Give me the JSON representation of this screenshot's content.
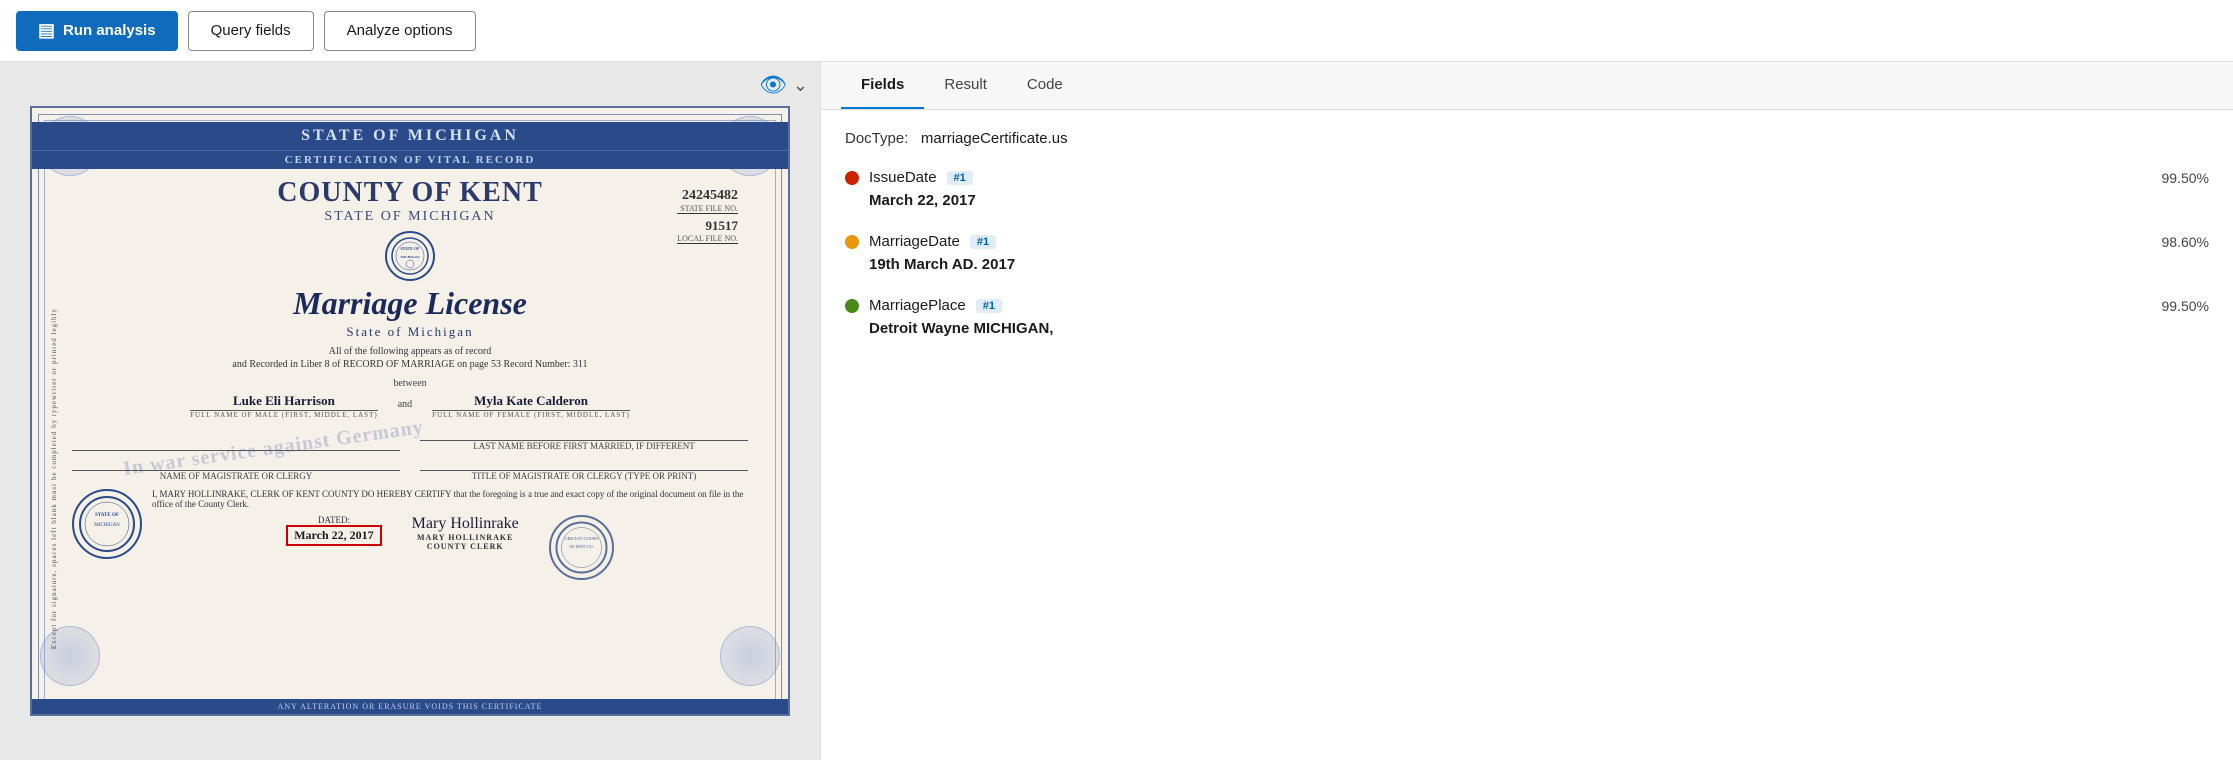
{
  "toolbar": {
    "run_analysis_label": "Run analysis",
    "query_fields_label": "Query fields",
    "analyze_options_label": "Analyze options",
    "run_icon": "▤"
  },
  "document": {
    "header_line1": "STATE OF MICHIGAN",
    "header_line2": "CERTIFICATION OF VITAL RECORD",
    "county": "COUNTY OF KENT",
    "state": "STATE OF MICHIGAN",
    "file_number_1": "24245482",
    "file_label_1": "STATE FILE NO.",
    "file_number_2": "91517",
    "file_label_2": "LOCAL FILE NO.",
    "title": "Marriage License",
    "subtitle": "State of Michigan",
    "body_text1": "All of the following appears as of record",
    "body_text2": "and Recorded in Liber  8  of RECORD OF MARRIAGE on page  53  Record Number:  311",
    "between_text": "between",
    "groom_name": "Luke Eli Harrison",
    "groom_label": "FULL NAME OF MALE (FIRST, MIDDLE, LAST)",
    "and_text": "and",
    "bride_name": "Myla Kate Calderon",
    "bride_label": "FULL NAME OF FEMALE (FIRST, MIDDLE, LAST)",
    "last_name_label": "LAST NAME BEFORE FIRST MARRIED, IF DIFFERENT",
    "magistrate_label": "NAME OF MAGISTRATE OR CLERGY",
    "title_label": "TITLE OF MAGISTRATE OR CLERGY (TYPE OR PRINT)",
    "ww2_stamp": "In war service against Germany",
    "certify_text": "I, MARY HOLLINRAKE, CLERK OF KENT COUNTY DO HEREBY CERTIFY that the foregoing is a true and exact copy of the original document on file in the office of the County Clerk.",
    "dated_label": "DATED:",
    "date_value": "March 22, 2017",
    "clerk_name": "Mary Hollinrake",
    "clerk_title": "MARY HOLLINRAKE",
    "clerk_role": "COUNTY CLERK",
    "footer_text": "ANY ALTERATION OR ERASURE VOIDS THIS CERTIFICATE"
  },
  "panel": {
    "tabs": [
      {
        "id": "fields",
        "label": "Fields",
        "active": true
      },
      {
        "id": "result",
        "label": "Result",
        "active": false
      },
      {
        "id": "code",
        "label": "Code",
        "active": false
      }
    ],
    "doctype_label": "DocType:",
    "doctype_value": "marriageCertificate.us",
    "fields": [
      {
        "name": "IssueDate",
        "badge": "#1",
        "dot_color": "#cc2200",
        "confidence": "99.50%",
        "value": "March 22, 2017"
      },
      {
        "name": "MarriageDate",
        "badge": "#1",
        "dot_color": "#e8960a",
        "confidence": "98.60%",
        "value": "19th March AD. 2017"
      },
      {
        "name": "MarriagePlace",
        "badge": "#1",
        "dot_color": "#4a8a1a",
        "confidence": "99.50%",
        "value": "Detroit Wayne MICHIGAN,"
      }
    ]
  }
}
